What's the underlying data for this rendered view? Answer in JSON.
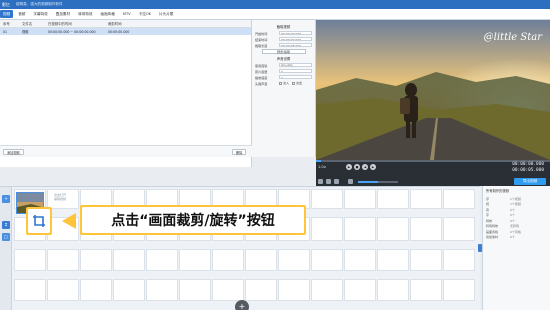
{
  "app": {
    "logo": "影忆",
    "title": "超简易、强大的视频制作软件"
  },
  "menu": [
    "视频",
    "音频",
    "字幕特效",
    "叠加素材",
    "转场特效",
    "画面风格",
    "MTV",
    "卡拉OK",
    "片头片尾"
  ],
  "list": {
    "headers": [
      "序号",
      "文件名",
      "在视频中的时间",
      "裁剪时间"
    ],
    "rows": [
      [
        "01",
        "视频",
        "00:00:00.000 ~ 00:00:00.000",
        "00:00:00.000"
      ]
    ],
    "add_button": "添加视频",
    "delete_button": "删除",
    "confirm_button": "确认修改"
  },
  "settings": {
    "section1_title": "截取视频",
    "start_label": "开始时间",
    "start_value": "00:00:00.000",
    "end_label": "结束时间",
    "end_value": "00:00:00.000",
    "duration_label": "截取长度",
    "duration_value": "00:00:05.000",
    "pick_button": "预览/截取",
    "section2_title": "声音设置",
    "track_label": "使用音轨",
    "track_value": "原片音轨",
    "volume_label": "原片音量",
    "volume_value": "0",
    "speed_label": "播放速度",
    "speed_value": "1",
    "fade_label": "头尾声音",
    "fade_in": "淡入",
    "fade_out": "淡出"
  },
  "preview": {
    "watermark": "@little Star"
  },
  "player": {
    "speed": "1.0x",
    "time_current": "00:00:00.000",
    "time_total": "00:00:05.000",
    "export_button": "导出视频",
    "progress": 0.02,
    "volume": 0.5,
    "play_icon": "play-icon",
    "prev_icon": "prev-icon",
    "next_icon": "next-icon",
    "stop_icon": "stop-icon"
  },
  "timeline": {
    "clip_label_lines": [
      "双击打开",
      "编辑视频"
    ],
    "add_icon": "plus-icon"
  },
  "callout": {
    "text": "点击“画面裁剪/旋转”按钮"
  },
  "properties": {
    "title": "所有制作的视频",
    "items": [
      {
        "k": "序",
        "v": "1个视频"
      },
      {
        "k": "视",
        "v": "1个视频"
      },
      {
        "k": "音",
        "v": "0个"
      },
      {
        "k": "字",
        "v": "0个"
      },
      {
        "k": "特效",
        "v": "0个"
      },
      {
        "k": "转场特效",
        "v": "无转场"
      },
      {
        "k": "画面风格",
        "v": "0个风格"
      },
      {
        "k": "叠加素材",
        "v": "0个"
      }
    ]
  },
  "colors": {
    "accent": "#2f76cc",
    "highlight": "#ffc43a",
    "export": "#2f9cf0"
  }
}
